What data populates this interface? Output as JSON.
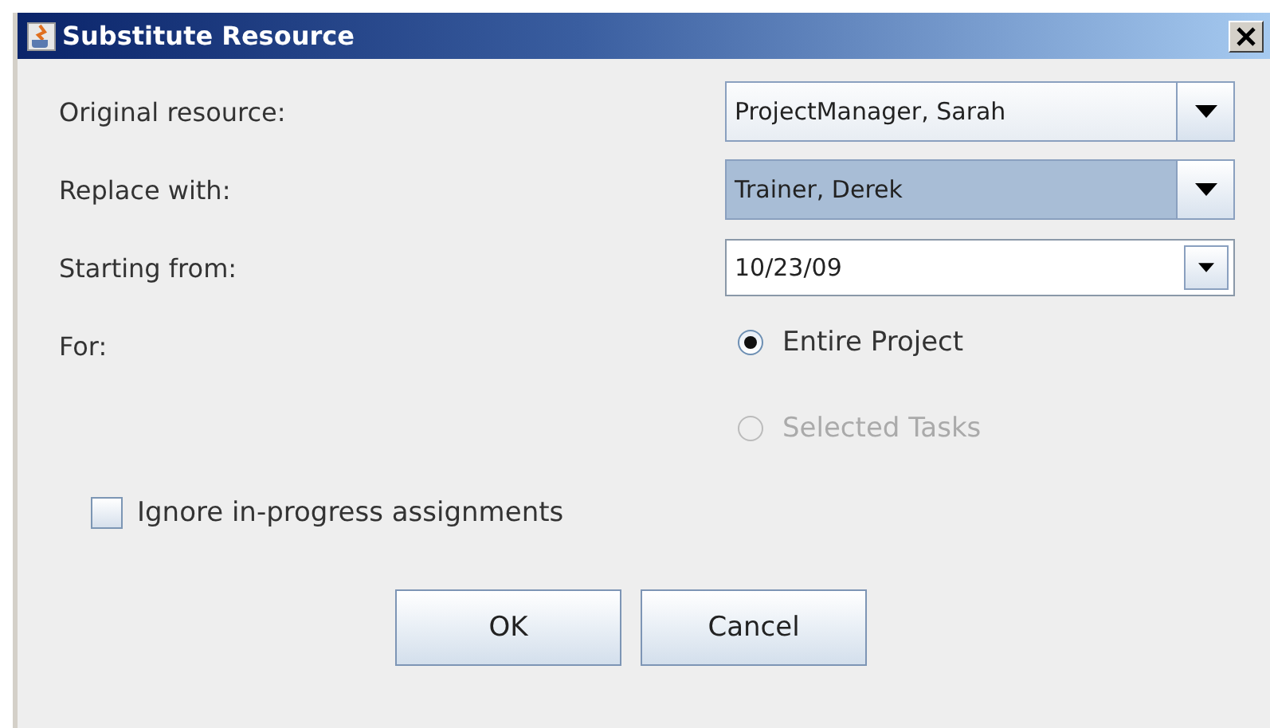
{
  "window": {
    "title": "Substitute Resource"
  },
  "fields": [
    {
      "label": "Original resource:",
      "kind": "dropdown",
      "value": "ProjectManager, Sarah",
      "highlighted": false
    },
    {
      "label": "Replace with:",
      "kind": "dropdown",
      "value": "Trainer, Derek",
      "highlighted": true
    },
    {
      "label": "Starting from:",
      "kind": "editable",
      "value": "10/23/09",
      "highlighted": false
    }
  ],
  "for_label": "For:",
  "scope_options": [
    {
      "label": "Entire Project",
      "selected": true,
      "disabled": false
    },
    {
      "label": "Selected Tasks",
      "selected": false,
      "disabled": true
    }
  ],
  "ignore_checkbox": {
    "label": "Ignore in-progress assignments",
    "checked": false
  },
  "buttons": [
    "OK",
    "Cancel"
  ]
}
